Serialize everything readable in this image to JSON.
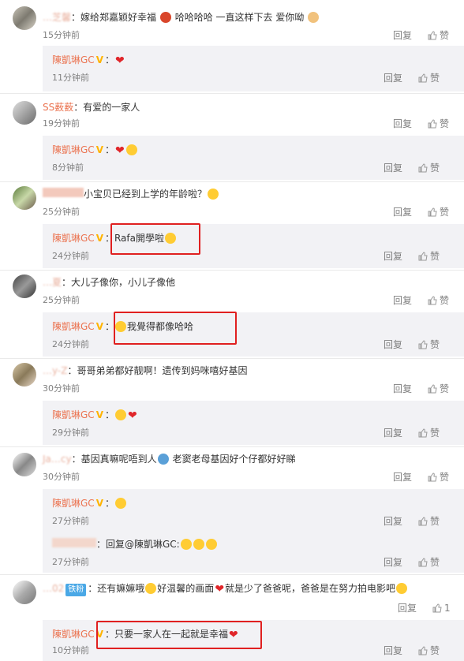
{
  "comments": [
    {
      "user": "…芝馨",
      "text": "：嫁给郑嘉颖好幸福",
      "text2": "哈哈哈哈   一直这样下去   爱你呦",
      "time": "15分钟前",
      "reply_label": "回复",
      "like_label": "赞",
      "reply": {
        "user": "陳凱琳GC",
        "text": "：",
        "time": "11分钟前",
        "reply_label": "回复",
        "like_label": "赞"
      }
    },
    {
      "user": "SS薮薮",
      "text": "：有爱的一家人",
      "time": "19分钟前",
      "reply_label": "回复",
      "like_label": "赞",
      "reply": {
        "user": "陳凱琳GC",
        "text": "：",
        "time": "8分钟前",
        "reply_label": "回复",
        "like_label": "赞"
      }
    },
    {
      "user": "",
      "text": "小宝贝已经到上学的年龄啦？",
      "time": "25分钟前",
      "reply_label": "回复",
      "like_label": "赞",
      "reply": {
        "user": "陳凱琳GC",
        "text": "：Rafa開學啦",
        "time": "24分钟前",
        "reply_label": "回复",
        "like_label": "赞"
      }
    },
    {
      "user": "…夏",
      "text": "：大儿子像你，小儿子像他",
      "time": "25分钟前",
      "reply_label": "回复",
      "like_label": "赞",
      "reply": {
        "user": "陳凱琳GC",
        "text": "：",
        "text2": "我覺得都像哈哈",
        "time": "24分钟前",
        "reply_label": "回复",
        "like_label": "赞"
      }
    },
    {
      "user": "…y-Z",
      "text": "：哥哥弟弟都好靓啊！遗传到妈咪嘻好基因",
      "time": "30分钟前",
      "reply_label": "回复",
      "like_label": "赞",
      "reply": {
        "user": "陳凱琳GC",
        "text": "：",
        "time": "29分钟前",
        "reply_label": "回复",
        "like_label": "赞"
      }
    },
    {
      "user": "Ja…cy",
      "text": "：基因真嘛呢唔到人",
      "text2": "老窦老母基因好个仔都好好睇",
      "time": "30分钟前",
      "reply_label": "回复",
      "like_label": "赞",
      "reply": {
        "user": "陳凱琳GC",
        "text": "：",
        "time": "27分钟前",
        "reply_label": "回复",
        "like_label": "赞"
      }
    },
    {
      "user": "…",
      "text": "：回复@陳凱琳GC:",
      "time": "27分钟前",
      "reply_label": "回复",
      "like_label": "赞"
    },
    {
      "user": "…02",
      "badge": "铁粉",
      "text": "：还有嫲嫲哦",
      "text2": "好温馨的画面",
      "text3": "就是少了爸爸呢，爸爸是在努力拍电影吧",
      "time": "",
      "reply_label": "回复",
      "like_label": "1",
      "reply": {
        "user": "陳凱琳GC",
        "text": "：只要一家人在一起就是幸福",
        "time": "10分钟前",
        "reply_label": "回复",
        "like_label": "赞"
      }
    }
  ],
  "colors": {
    "username": "#eb7350",
    "highlight": "#e02020",
    "reply_bg": "#f2f2f5",
    "muted": "#808080"
  }
}
